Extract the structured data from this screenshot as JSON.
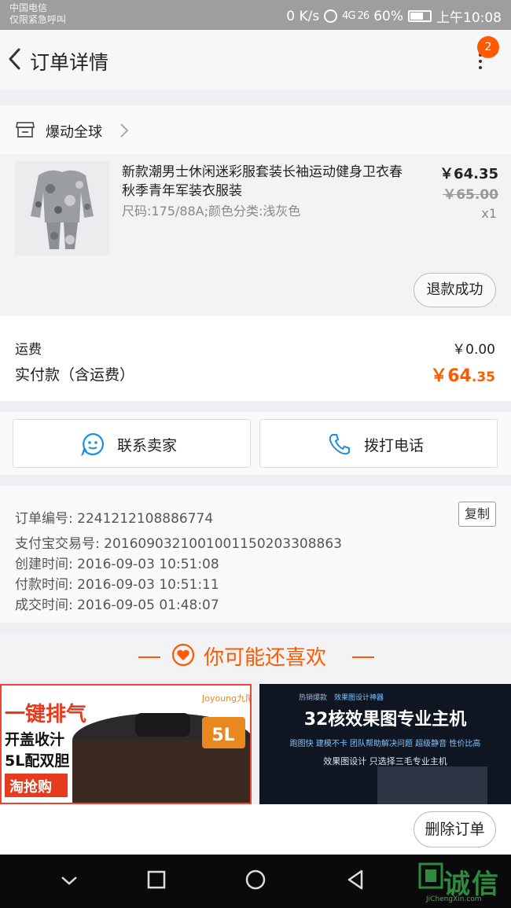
{
  "status_bar": {
    "carrier1": "中国电信",
    "carrier2": "仅限紧急呼叫",
    "net_speed": "0 K/s",
    "signal": "4G 26",
    "battery": "60%",
    "time": "上午10:08"
  },
  "header": {
    "title": "订单详情",
    "badge": "2"
  },
  "shop": {
    "name": "爆动全球"
  },
  "item": {
    "title": "新款潮男士休闲迷彩服套装长袖运动健身卫衣春秋季青年军装衣服装",
    "spec": "尺码:175/88A;颜色分类:浅灰色",
    "price": "￥64.35",
    "original_price": "￥65.00",
    "quantity": "x1",
    "status_button": "退款成功"
  },
  "fees": {
    "shipping_label": "运费",
    "shipping_value": "￥0.00",
    "paid_label": "实付款（含运费）",
    "paid_currency_int": "￥64",
    "paid_decimal": ".35"
  },
  "contact": {
    "seller_label": "联系卖家",
    "phone_label": "拨打电话"
  },
  "order": {
    "number": "订单编号: 2241212108886774",
    "copy_label": "复制",
    "alipay": "支付宝交易号: 2016090321001001150203308863",
    "created": "创建时间: 2016-09-03 10:51:08",
    "paid": "付款时间: 2016-09-03 10:51:11",
    "completed": "成交时间: 2016-09-05 01:48:07"
  },
  "recommend": {
    "title": "你可能还喜欢",
    "ad_left": {
      "line1": "一键排气",
      "line2": "开盖收汁",
      "line3": "5L配双胆",
      "line4": "淘抢购",
      "brand": "Joyoung九阳",
      "badge": "5L"
    },
    "ad_right": {
      "tag1": "热销爆款",
      "tag2": "效果图设计神器",
      "headline": "32核效果图专业主机",
      "features": "跑图快  建模不卡  团队帮助解决问题  超级静音  性价比高",
      "sub": "效果图设计 只选择三毛专业主机"
    }
  },
  "bottom": {
    "delete_label": "删除订单"
  },
  "watermark": {
    "text": "诚信",
    "url": "JiChengXin.com"
  }
}
